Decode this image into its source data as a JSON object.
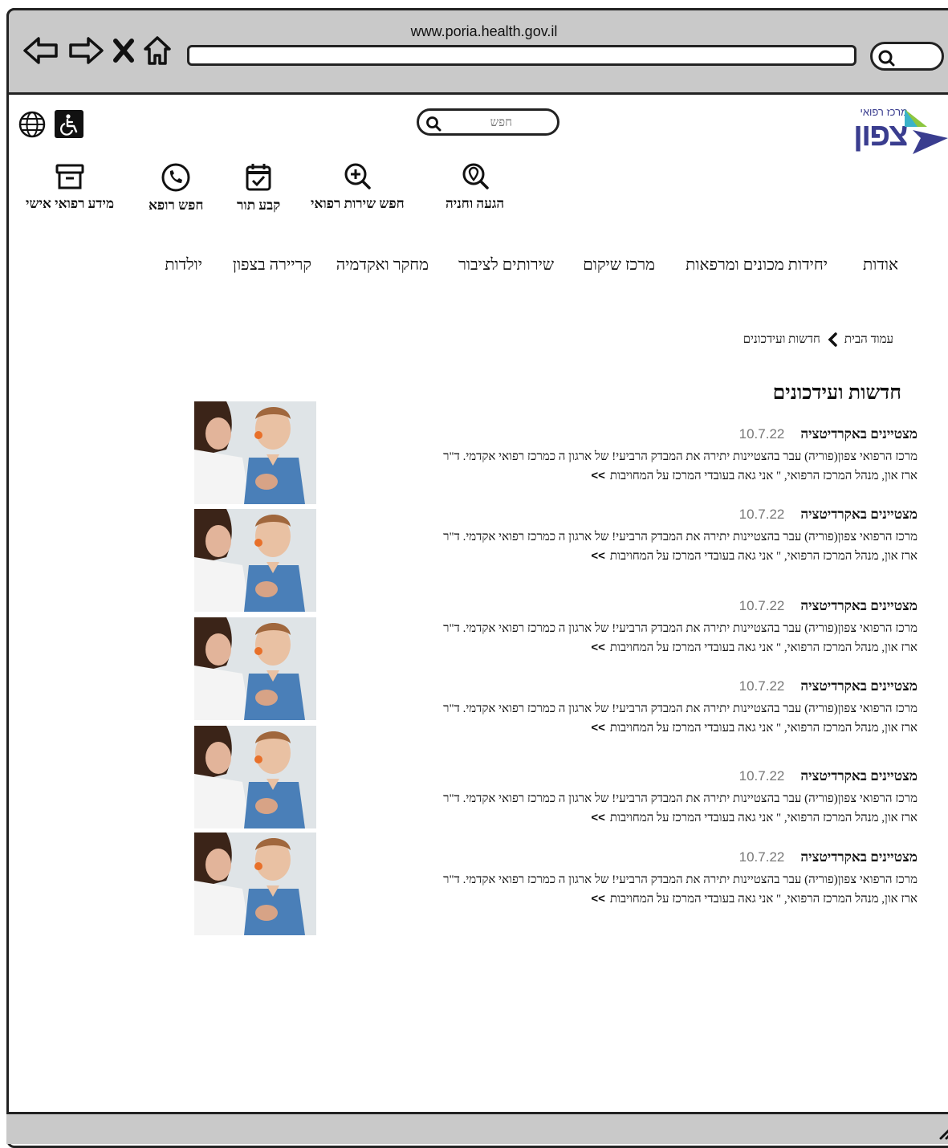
{
  "browser": {
    "url": "www.poria.health.gov.il"
  },
  "header": {
    "search_placeholder": "חפש",
    "logo_small": "מרכז רפואי",
    "logo_big": "צפון"
  },
  "quick_links": [
    {
      "label": "הגעה וחניה",
      "icon": "location-search-icon"
    },
    {
      "label": "חפש שירות רפואי",
      "icon": "zoom-plus-icon"
    },
    {
      "label": "קבע תור",
      "icon": "calendar-check-icon"
    },
    {
      "label": "חפש רופא",
      "icon": "phone-icon"
    },
    {
      "label": "מידע רפואי אישי",
      "icon": "archive-icon"
    }
  ],
  "main_nav": [
    {
      "label": "אודות"
    },
    {
      "label": "יחידות מכונים ומרפאות"
    },
    {
      "label": "מרכז שיקום"
    },
    {
      "label": "שירותים לציבור"
    },
    {
      "label": "מחקר ואקדמיה"
    },
    {
      "label": "קריירה בצפון"
    },
    {
      "label": "יולדות"
    }
  ],
  "breadcrumb": {
    "home": "עמוד הבית",
    "current": "חדשות ועידכונים"
  },
  "page_title": "חדשות ועידכונים",
  "news": [
    {
      "title": "מצטיינים באקרדיטציה",
      "date": "10.7.22",
      "line1": "מרכז הרפואי צפון(פוריה) עבר בהצטיינות יתירה את המבדק הרביעי! של ארגון ה כמרכז רפואי אקדמי. ד\"ר",
      "line2": "ארז און, מנהל המרכז הרפואי, \" אני גאה בעובדי המרכז על המחויבות",
      "more": ">>"
    },
    {
      "title": "מצטיינים באקרדיטציה",
      "date": "10.7.22",
      "line1": "מרכז הרפואי צפון(פוריה) עבר בהצטיינות יתירה את המבדק הרביעי! של ארגון ה כמרכז רפואי אקדמי. ד\"ר",
      "line2": "ארז און, מנהל המרכז הרפואי, \" אני גאה בעובדי המרכז על המחויבות",
      "more": ">>"
    },
    {
      "title": "מצטיינים באקרדיטציה",
      "date": "10.7.22",
      "line1": "מרכז הרפואי צפון(פוריה) עבר בהצטיינות יתירה את המבדק הרביעי! של ארגון ה כמרכז רפואי אקדמי. ד\"ר",
      "line2": "ארז און, מנהל המרכז הרפואי, \" אני גאה בעובדי המרכז על המחויבות",
      "more": ">>"
    },
    {
      "title": "מצטיינים באקרדיטציה",
      "date": "10.7.22",
      "line1": "מרכז הרפואי צפון(פוריה) עבר בהצטיינות יתירה את המבדק הרביעי! של ארגון ה כמרכז רפואי אקדמי. ד\"ר",
      "line2": "ארז און, מנהל המרכז הרפואי, \" אני גאה בעובדי המרכז על המחויבות",
      "more": ">>"
    },
    {
      "title": "מצטיינים באקרדיטציה",
      "date": "10.7.22",
      "line1": "מרכז הרפואי צפון(פוריה) עבר בהצטיינות יתירה את המבדק הרביעי! של ארגון ה כמרכז רפואי אקדמי. ד\"ר",
      "line2": "ארז און, מנהל המרכז הרפואי, \" אני גאה בעובדי המרכז על המחויבות",
      "more": ">>"
    },
    {
      "title": "מצטיינים באקרדיטציה",
      "date": "10.7.22",
      "line1": "מרכז הרפואי צפון(פוריה) עבר בהצטיינות יתירה את המבדק הרביעי! של ארגון ה כמרכז רפואי אקדמי. ד\"ר",
      "line2": "ארז און, מנהל המרכז הרפואי, \" אני גאה בעובדי המרכז על המחויבות",
      "more": ">>"
    }
  ],
  "colors": {
    "brand_blue": "#3a3d8f",
    "brand_teal": "#3bb3c9",
    "brand_green": "#8cc63f",
    "chrome_gray": "#c9c9c9"
  }
}
